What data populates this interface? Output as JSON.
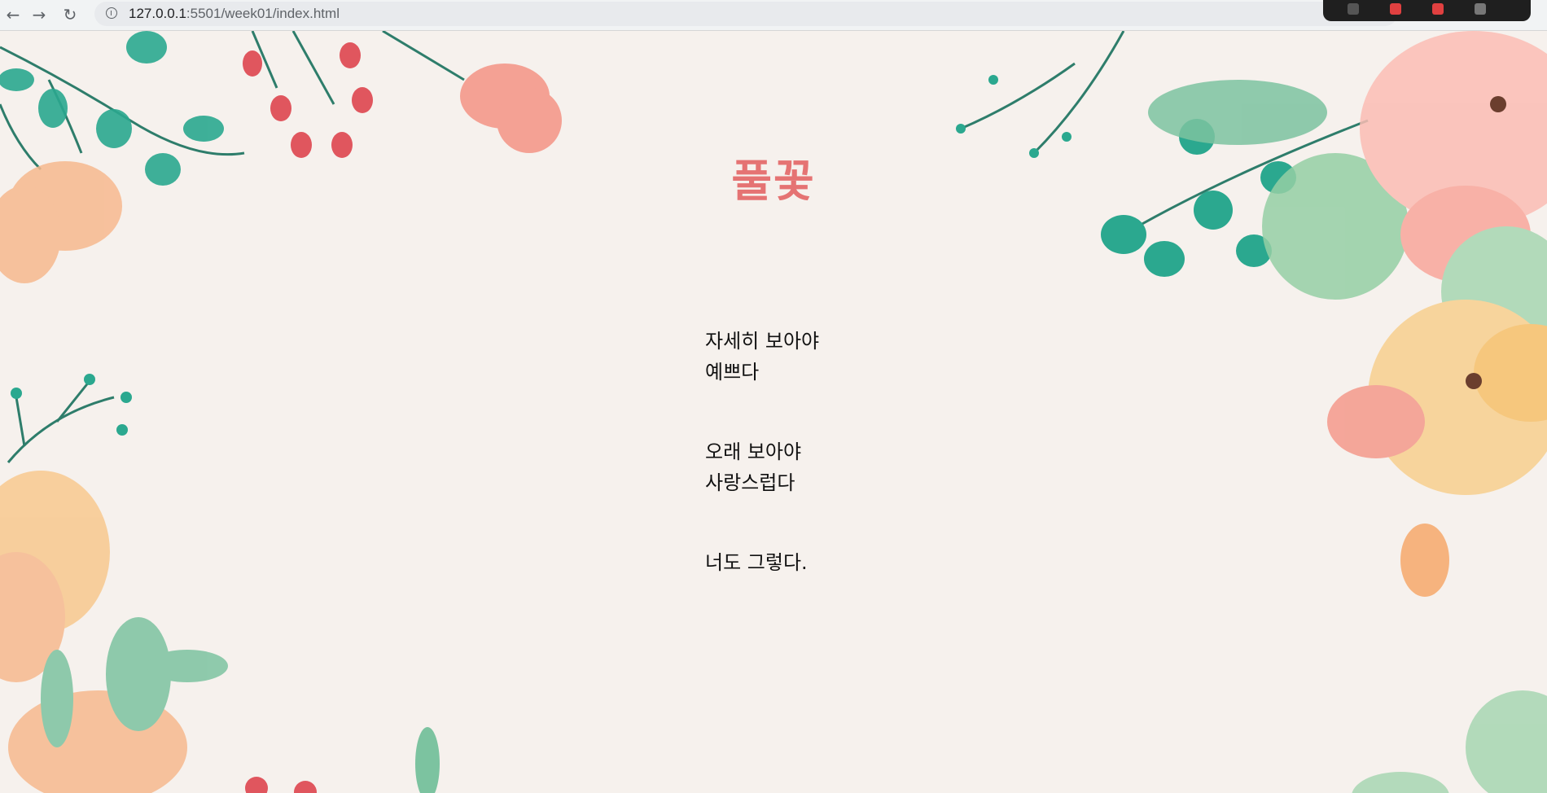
{
  "browser": {
    "url_host": "127.0.0.1",
    "url_path": ":5501/week01/index.html",
    "back_icon": "back-arrow-icon",
    "forward_icon": "forward-arrow-icon",
    "reload_icon": "reload-icon",
    "info_icon": "site-info-icon"
  },
  "page": {
    "title": "풀꽃",
    "stanzas": [
      {
        "lines": [
          "자세히 보아야",
          "예쁘다"
        ]
      },
      {
        "lines": [
          "오래 보아야",
          "사랑스럽다"
        ]
      },
      {
        "lines": [
          "너도 그렇다."
        ]
      }
    ]
  },
  "colors": {
    "background": "#f6f1ed",
    "title": "#e57373",
    "text": "#111111"
  }
}
